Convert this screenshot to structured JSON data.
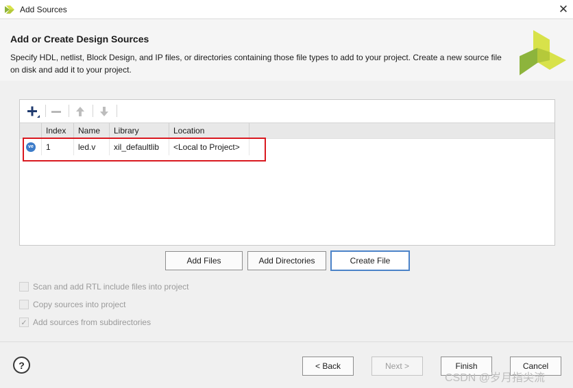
{
  "window": {
    "title": "Add Sources",
    "close_glyph": "✕"
  },
  "header": {
    "title": "Add or Create Design Sources",
    "description": "Specify HDL, netlist, Block Design, and IP files, or directories containing those file types to add to your project. Create a new source file on disk and add it to your project."
  },
  "toolbar": {
    "add_icon": "plus-icon",
    "remove_icon": "minus-icon",
    "move_up_icon": "arrow-up-icon",
    "move_down_icon": "arrow-down-icon"
  },
  "table": {
    "columns": [
      "Index",
      "Name",
      "Library",
      "Location"
    ],
    "rows": [
      {
        "icon": "ve",
        "index": "1",
        "name": "led.v",
        "library": "xil_defaultlib",
        "location": "<Local to Project>"
      }
    ]
  },
  "buttons": {
    "add_files": "Add Files",
    "add_directories": "Add Directories",
    "create_file": "Create File",
    "back": "< Back",
    "next": "Next >",
    "finish": "Finish",
    "cancel": "Cancel",
    "help": "?"
  },
  "options": [
    {
      "label": "Scan and add RTL include files into project",
      "checked": false
    },
    {
      "label": "Copy sources into project",
      "checked": false
    },
    {
      "label": "Add sources from subdirectories",
      "checked": true
    }
  ],
  "watermark": "CSDN @岁月指尖流",
  "colors": {
    "highlight": "#d9171e",
    "accent": "#4a82c8",
    "logo_green": "#8db43c",
    "logo_yellow": "#d8e24a"
  }
}
